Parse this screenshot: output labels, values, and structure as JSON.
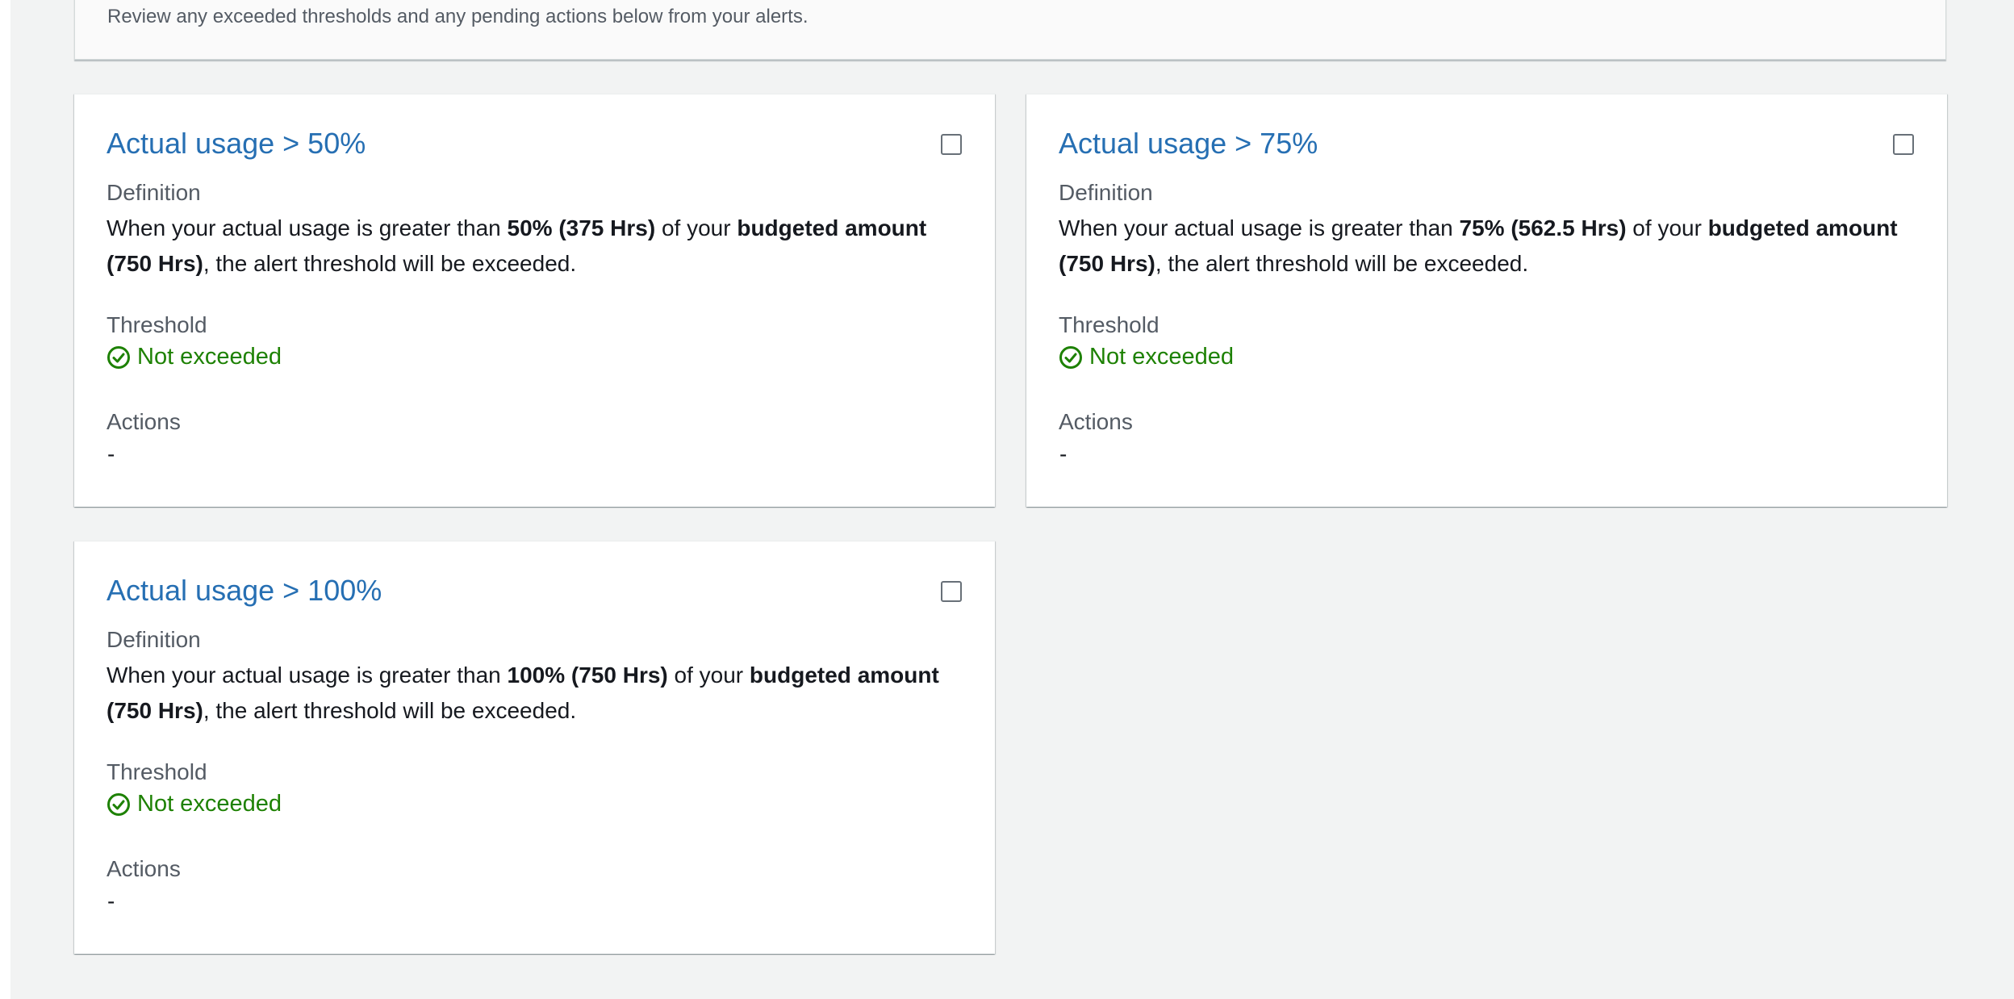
{
  "header": {
    "description": "Review any exceeded thresholds and any pending actions below from your alerts."
  },
  "labels": {
    "definition": "Definition",
    "threshold": "Threshold",
    "actions": "Actions"
  },
  "colors": {
    "title_link": "#266fb3",
    "status_ok": "#1d8102",
    "page_bg": "#f2f3f3"
  },
  "alerts": [
    {
      "title": "Actual usage > 50%",
      "def_prefix": "When your actual usage is greater than ",
      "def_threshold": "50% (375 Hrs)",
      "def_mid": " of your ",
      "def_budget": "budgeted amount (750 Hrs)",
      "def_suffix": ", the alert threshold will be exceeded.",
      "status": "Not exceeded",
      "status_icon": "check-circle-icon",
      "actions": "-"
    },
    {
      "title": "Actual usage > 75%",
      "def_prefix": "When your actual usage is greater than ",
      "def_threshold": "75% (562.5 Hrs)",
      "def_mid": " of your ",
      "def_budget": "budgeted amount (750 Hrs)",
      "def_suffix": ", the alert threshold will be exceeded.",
      "status": "Not exceeded",
      "status_icon": "check-circle-icon",
      "actions": "-"
    },
    {
      "title": "Actual usage > 100%",
      "def_prefix": "When your actual usage is greater than ",
      "def_threshold": "100% (750 Hrs)",
      "def_mid": " of your ",
      "def_budget": "budgeted amount (750 Hrs)",
      "def_suffix": ", the alert threshold will be exceeded.",
      "status": "Not exceeded",
      "status_icon": "check-circle-icon",
      "actions": "-"
    }
  ]
}
